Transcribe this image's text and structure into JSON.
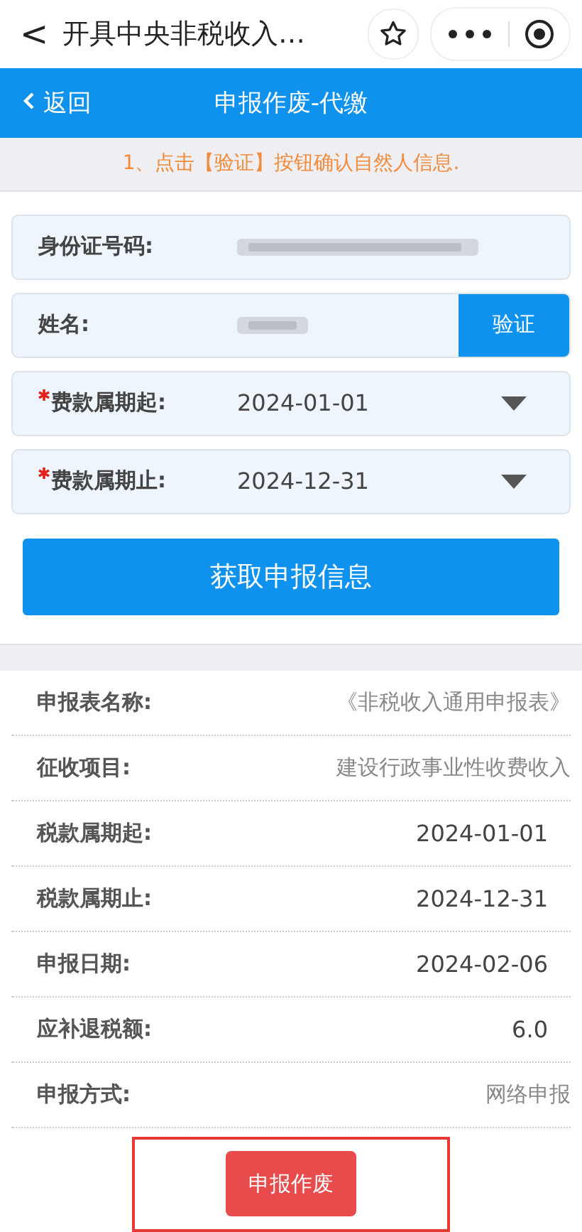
{
  "topbar": {
    "back": "<",
    "title": "开具中央非税收入…"
  },
  "header": {
    "back": "返回",
    "title": "申报作废-代缴"
  },
  "notice": "1、点击【验证】按钮确认自然人信息.",
  "fields": [
    {
      "kind": "redacted",
      "label": "身份证号码:",
      "required": false
    },
    {
      "kind": "redacted-verify",
      "label": "姓名:",
      "required": false,
      "button": "验证"
    },
    {
      "kind": "select",
      "label": "费款属期起:",
      "required": true,
      "value": "2024-01-01"
    },
    {
      "kind": "select",
      "label": "费款属期止:",
      "required": true,
      "value": "2024-12-31"
    }
  ],
  "fetch_button": "获取申报信息",
  "details": [
    {
      "label": "申报表名称:",
      "value": "《非税收入通用申报表》",
      "muted": true
    },
    {
      "label": "征收项目:",
      "value": "建设行政事业性收费收入",
      "muted": true
    },
    {
      "label": "税款属期起:",
      "value": "2024-01-01",
      "muted": false
    },
    {
      "label": "税款属期止:",
      "value": "2024-12-31",
      "muted": false
    },
    {
      "label": "申报日期:",
      "value": "2024-02-06",
      "muted": false
    },
    {
      "label": "应补退税额:",
      "value": "6.0",
      "muted": false
    },
    {
      "label": "申报方式:",
      "value": "网络申报",
      "muted": true
    }
  ],
  "void_button": "申报作废"
}
